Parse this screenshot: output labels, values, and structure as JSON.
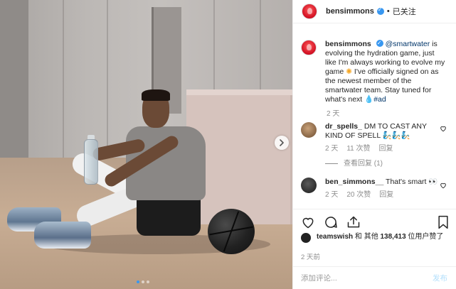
{
  "photo": {
    "carousel_dots": 3,
    "active_dot": 0
  },
  "header": {
    "username": "bensimmons",
    "follow_label": "已关注",
    "separator": "•"
  },
  "caption": {
    "username": "bensimmons",
    "mention": "@smartwater",
    "text_before_emoji": " is evolving the hydration game, just like I'm always working to evolve my game ",
    "emoji_1": "✺",
    "text_after_emoji": " I've officially signed on as the newest member of the smartwater team. Stay tuned for what's next ",
    "emoji_2": "💧",
    "hashtag": "#ad",
    "time": "2 天"
  },
  "comments": [
    {
      "username": "dr_spells_",
      "text": "DM TO CAST ANY KIND OF SPELL ",
      "emoji": "🧞🧞🧞",
      "time": "2 天",
      "likes": "11 次赞",
      "reply_label": "回复",
      "view_replies": "查看回复 (1)"
    },
    {
      "username": "ben_simmons__",
      "text": "That's smart ",
      "emoji": "👀",
      "time": "2 天",
      "likes": "20 次赞",
      "reply_label": "回复"
    }
  ],
  "likes": {
    "user": "teamswish",
    "text": " 和 其他 ",
    "count": "138,413",
    "suffix": " 位用户赞了"
  },
  "post_time": "2 天前",
  "comment_input": {
    "placeholder": "添加评论...",
    "post_label": "发布"
  },
  "colors": {
    "accent": "#3897f0",
    "brand_red": "#d10f22",
    "muted_text": "#8e8e8e",
    "post_disabled": "#b2dffc"
  },
  "icons": [
    "chevron-right-icon",
    "verified-badge-icon",
    "heart-icon",
    "comment-icon",
    "share-icon",
    "bookmark-icon"
  ]
}
